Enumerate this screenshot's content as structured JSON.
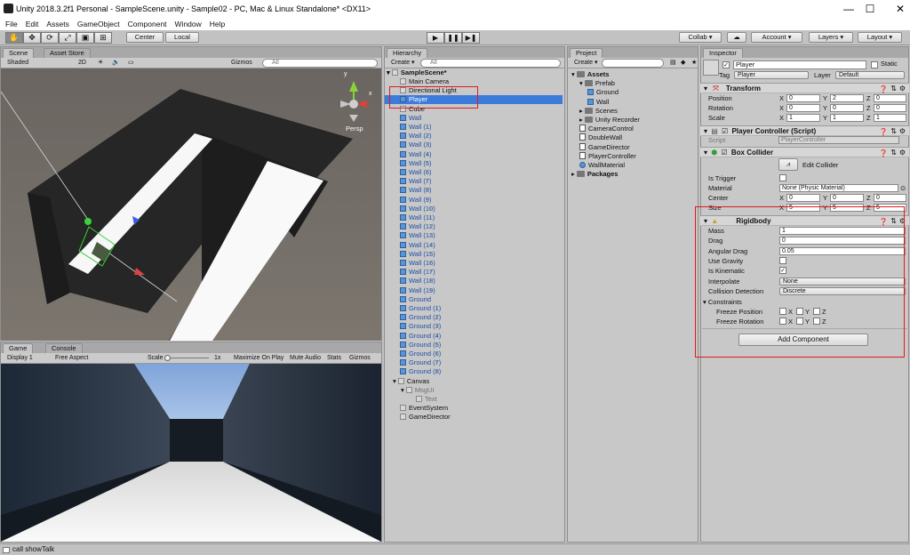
{
  "window": {
    "title": "Unity 2018.3.2f1 Personal - SampleScene.unity - Sample02 - PC, Mac & Linux Standalone* <DX11>",
    "minimize": "—",
    "maximize": "☐",
    "close": "✕"
  },
  "menu": [
    "File",
    "Edit",
    "Assets",
    "GameObject",
    "Component",
    "Window",
    "Help"
  ],
  "toolbar": {
    "center": "Center",
    "local": "Local",
    "collab": "Collab ▾",
    "account": "Account",
    "layers": "Layers",
    "layout": "Layout"
  },
  "scene": {
    "tabs": [
      "Scene",
      "Asset Store"
    ],
    "shading": "Shaded",
    "mode2d": "2D",
    "gizmos": "Gizmos",
    "search": "All",
    "persp": "Persp",
    "axis_y": "y",
    "axis_x": "x"
  },
  "game": {
    "tabs": [
      "Game",
      "Console"
    ],
    "display": "Display 1",
    "aspect": "Free Aspect",
    "scale_label": "Scale",
    "scale_value": "1x",
    "maximize": "Maximize On Play",
    "mute": "Mute Audio",
    "stats": "Stats",
    "gizmos": "Gizmos"
  },
  "hierarchy": {
    "tab": "Hierarchy",
    "create": "Create",
    "search": "All",
    "scene": "SampleScene*",
    "items": [
      {
        "label": "Main Camera",
        "kind": "gray",
        "indent": 1
      },
      {
        "label": "Directional Light",
        "kind": "gray",
        "indent": 1
      },
      {
        "label": "Player",
        "kind": "blue",
        "indent": 1,
        "selected": true
      },
      {
        "label": "Cube",
        "kind": "gray",
        "indent": 1
      },
      {
        "label": "Wall",
        "kind": "blue",
        "indent": 1,
        "chev": true
      },
      {
        "label": "Wall (1)",
        "kind": "blue",
        "indent": 1,
        "chev": true
      },
      {
        "label": "Wall (2)",
        "kind": "blue",
        "indent": 1,
        "chev": true
      },
      {
        "label": "Wall (3)",
        "kind": "blue",
        "indent": 1,
        "chev": true
      },
      {
        "label": "Wall (4)",
        "kind": "blue",
        "indent": 1,
        "chev": true
      },
      {
        "label": "Wall (5)",
        "kind": "blue",
        "indent": 1,
        "chev": true
      },
      {
        "label": "Wall (6)",
        "kind": "blue",
        "indent": 1,
        "chev": true
      },
      {
        "label": "Wall (7)",
        "kind": "blue",
        "indent": 1,
        "chev": true
      },
      {
        "label": "Wall (8)",
        "kind": "blue",
        "indent": 1,
        "chev": true
      },
      {
        "label": "Wall (9)",
        "kind": "blue",
        "indent": 1,
        "chev": true
      },
      {
        "label": "Wall (10)",
        "kind": "blue",
        "indent": 1,
        "chev": true
      },
      {
        "label": "Wall (11)",
        "kind": "blue",
        "indent": 1,
        "chev": true
      },
      {
        "label": "Wall (12)",
        "kind": "blue",
        "indent": 1,
        "chev": true
      },
      {
        "label": "Wall (13)",
        "kind": "blue",
        "indent": 1,
        "chev": true
      },
      {
        "label": "Wall (14)",
        "kind": "blue",
        "indent": 1,
        "chev": true
      },
      {
        "label": "Wall (15)",
        "kind": "blue",
        "indent": 1,
        "chev": true
      },
      {
        "label": "Wall (16)",
        "kind": "blue",
        "indent": 1,
        "chev": true
      },
      {
        "label": "Wall (17)",
        "kind": "blue",
        "indent": 1,
        "chev": true
      },
      {
        "label": "Wall (18)",
        "kind": "blue",
        "indent": 1,
        "chev": true
      },
      {
        "label": "Wall (19)",
        "kind": "blue",
        "indent": 1,
        "chev": true
      },
      {
        "label": "Ground",
        "kind": "blue",
        "indent": 1,
        "chev": true
      },
      {
        "label": "Ground (1)",
        "kind": "blue",
        "indent": 1,
        "chev": true
      },
      {
        "label": "Ground (2)",
        "kind": "blue",
        "indent": 1,
        "chev": true
      },
      {
        "label": "Ground (3)",
        "kind": "blue",
        "indent": 1,
        "chev": true
      },
      {
        "label": "Ground (4)",
        "kind": "blue",
        "indent": 1,
        "chev": true
      },
      {
        "label": "Ground (5)",
        "kind": "blue",
        "indent": 1,
        "chev": true
      },
      {
        "label": "Ground (6)",
        "kind": "blue",
        "indent": 1,
        "chev": true
      },
      {
        "label": "Ground (7)",
        "kind": "blue",
        "indent": 1,
        "chev": true
      },
      {
        "label": "Ground (8)",
        "kind": "blue",
        "indent": 1,
        "chev": true
      },
      {
        "label": "Canvas",
        "kind": "gray",
        "indent": 1,
        "fold": true
      },
      {
        "label": "MsgUI",
        "kind": "gray",
        "indent": 2,
        "fold": true,
        "dim": true
      },
      {
        "label": "Text",
        "kind": "gray",
        "indent": 3,
        "dim": true
      },
      {
        "label": "EventSystem",
        "kind": "gray",
        "indent": 1
      },
      {
        "label": "GameDirector",
        "kind": "gray",
        "indent": 1
      }
    ]
  },
  "project": {
    "tab": "Project",
    "create": "Create",
    "items": [
      {
        "label": "Assets",
        "icon": "folder",
        "indent": 0,
        "bold": true
      },
      {
        "label": "Prefab",
        "icon": "folder",
        "indent": 1
      },
      {
        "label": "Ground",
        "icon": "cube",
        "indent": 2
      },
      {
        "label": "Wall",
        "icon": "cube",
        "indent": 2
      },
      {
        "label": "Scenes",
        "icon": "folder",
        "indent": 1
      },
      {
        "label": "Unity Recorder",
        "icon": "folder",
        "indent": 1
      },
      {
        "label": "CameraControl",
        "icon": "script",
        "indent": 1
      },
      {
        "label": "DoubleWall",
        "icon": "script",
        "indent": 1
      },
      {
        "label": "GameDirector",
        "icon": "script",
        "indent": 1
      },
      {
        "label": "PlayerController",
        "icon": "script",
        "indent": 1
      },
      {
        "label": "WallMaterial",
        "icon": "material",
        "indent": 1
      },
      {
        "label": "Packages",
        "icon": "folder",
        "indent": 0,
        "bold": true
      }
    ]
  },
  "inspector": {
    "tab": "Inspector",
    "object_name": "Player",
    "static": "Static",
    "tag_label": "Tag",
    "tag_value": "Player",
    "layer_label": "Layer",
    "layer_value": "Default",
    "transform": {
      "title": "Transform",
      "position": {
        "label": "Position",
        "x": "0",
        "y": "2",
        "z": "0"
      },
      "rotation": {
        "label": "Rotation",
        "x": "0",
        "y": "0",
        "z": "0"
      },
      "scale": {
        "label": "Scale",
        "x": "1",
        "y": "1",
        "z": "1"
      }
    },
    "player_controller": {
      "title": "Player Controller (Script)",
      "script_label": "Script",
      "script_value": "PlayerController"
    },
    "box_collider": {
      "title": "Box Collider",
      "edit": "Edit Collider",
      "is_trigger": "Is Trigger",
      "material_label": "Material",
      "material_value": "None (Physic Material)",
      "center": {
        "label": "Center",
        "x": "0",
        "y": "0",
        "z": "0"
      },
      "size": {
        "label": "Size",
        "x": "5",
        "y": "5",
        "z": "5"
      }
    },
    "rigidbody": {
      "title": "Rigidbody",
      "mass_label": "Mass",
      "mass": "1",
      "drag_label": "Drag",
      "drag": "0",
      "angular_label": "Angular Drag",
      "angular": "0.05",
      "gravity_label": "Use Gravity",
      "kinematic_label": "Is Kinematic",
      "interpolate_label": "Interpolate",
      "interpolate": "None",
      "collision_label": "Collision Detection",
      "collision": "Discrete",
      "constraints": "Constraints",
      "freeze_pos": "Freeze Position",
      "freeze_rot": "Freeze Rotation",
      "x": "X",
      "y": "Y",
      "z": "Z"
    },
    "add_component": "Add Component"
  },
  "status": "call showTalk",
  "colors": {
    "accent": "#3d7bdb",
    "highlight": "#e01b1b"
  }
}
